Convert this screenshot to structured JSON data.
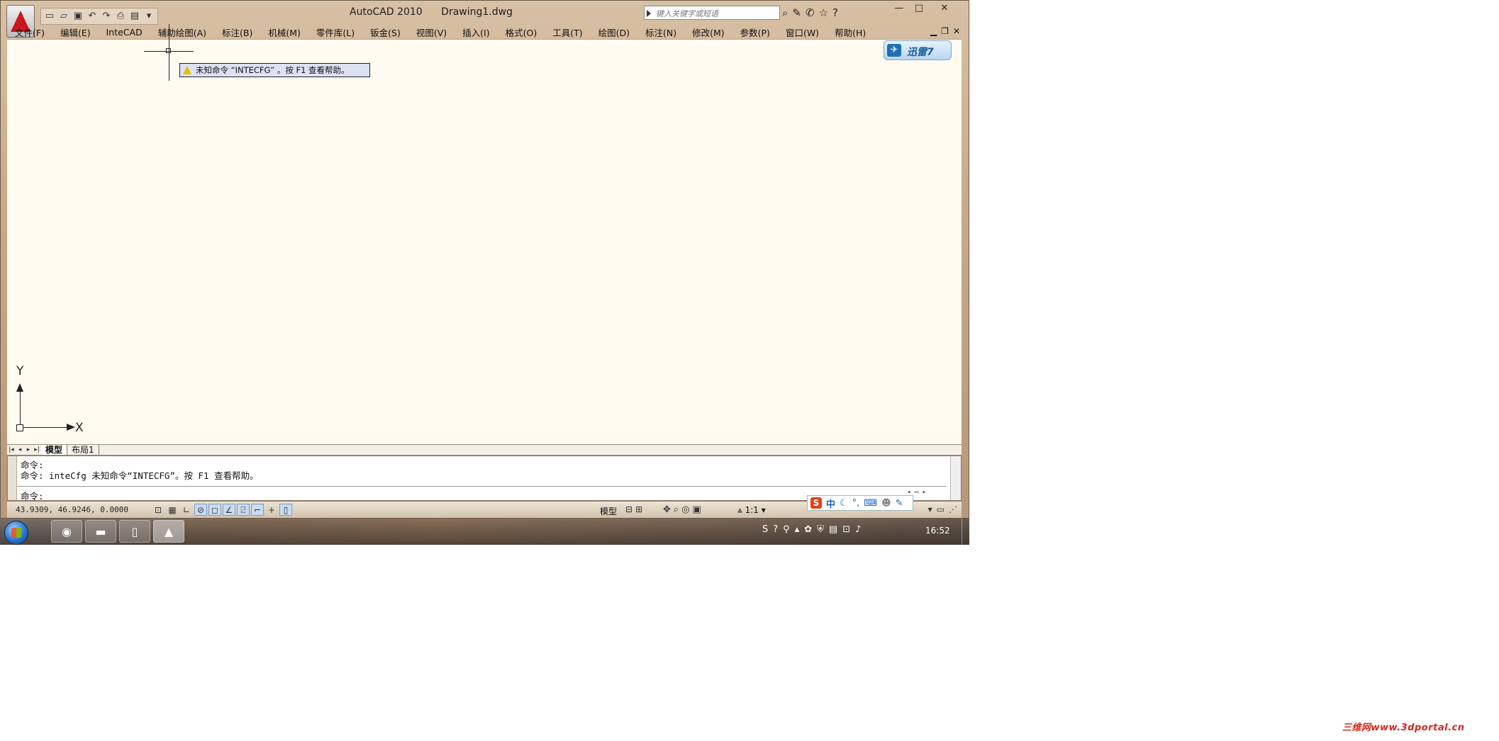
{
  "window": {
    "app_title": "AutoCAD 2010",
    "doc_title": "Drawing1.dwg",
    "search_placeholder": "键入关键字或短语",
    "controls": {
      "minimize": "—",
      "maximize": "□",
      "close": "✕"
    }
  },
  "qat": {
    "icons": [
      "new-icon",
      "open-icon",
      "save-icon",
      "undo-icon",
      "redo-icon",
      "plot-icon",
      "workspace-icon"
    ]
  },
  "menu": [
    "文件(F)",
    "编辑(E)",
    "InteCAD",
    "辅助绘图(A)",
    "标注(B)",
    "机械(M)",
    "零件库(L)",
    "钣金(S)",
    "视图(V)",
    "插入(I)",
    "格式(O)",
    "工具(T)",
    "绘图(D)",
    "标注(N)",
    "修改(M)",
    "参数(P)",
    "窗口(W)",
    "帮助(H)"
  ],
  "doc_controls": {
    "minimize": "▁",
    "restore": "❐",
    "close": "✕"
  },
  "xunlei": {
    "label": "迅雷7"
  },
  "tooltip": {
    "text": "未知命令 “INTECFG” 。按 F1 查看帮助。"
  },
  "ucs": {
    "x": "X",
    "y": "Y"
  },
  "layout_tabs": {
    "model": "模型",
    "layout1": "布局1"
  },
  "command": {
    "line1": "命令:",
    "line2": "命令: inteCfg 未知命令“INTECFG”。按 F1 查看帮助。",
    "prompt": "命令:"
  },
  "status": {
    "coords": "43.9309, 46.9246, 0.0000",
    "model_label": "模型",
    "scale": "1:1"
  },
  "ime": {
    "logo": "S",
    "mode": "中"
  },
  "taskbar": {
    "clock": "16:52"
  },
  "watermark": {
    "text": "三维网www.3dportal.cn"
  },
  "colors": {
    "canvas": "#fffbf0",
    "accent_red": "#c7191e",
    "tooltip_bg": "#dde2f3"
  }
}
